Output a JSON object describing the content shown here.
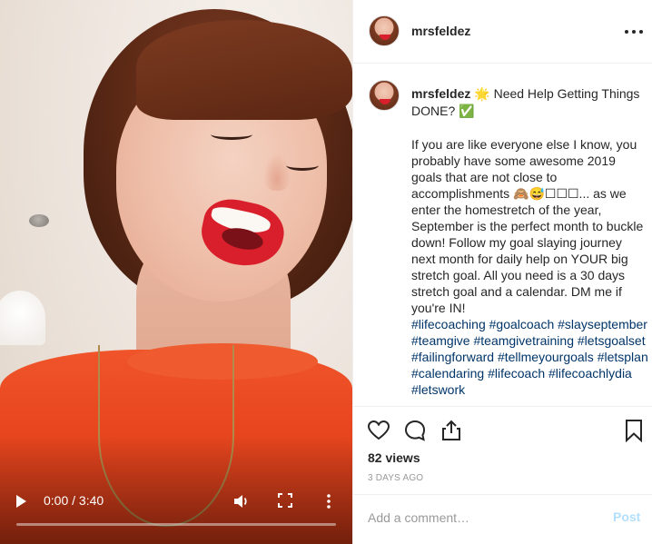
{
  "post": {
    "username": "mrsfeldez",
    "caption_headline_emoji": "🌟",
    "caption_headline": "Need Help Getting Things DONE?",
    "caption_headline_check": "✅",
    "caption_body": "If you are like everyone else I know, you probably have some awesome 2019 goals that are not close to accomplishments 🙈😅☐☐☐... as we enter the homestretch of the year, September is the perfect month to buckle down! Follow my goal slaying journey next month for daily help on YOUR big stretch goal. All you need is a 30 days stretch goal and a calendar. DM me if you're IN!",
    "hashtags": [
      "#lifecoaching",
      "#goalcoach",
      "#slayseptember",
      "#teamgive",
      "#teamgivetraining",
      "#letsgoalset",
      "#failingforward",
      "#tellmeyourgoals",
      "#letsplan",
      "#calendaring",
      "#lifecoach",
      "#lifecoachlydia",
      "#letswork"
    ],
    "views": "82 views",
    "date": "3 DAYS AGO"
  },
  "video": {
    "time": "0:00 / 3:40",
    "progress": 0
  },
  "comment": {
    "placeholder": "Add a comment…",
    "post_label": "Post"
  },
  "icons": {
    "more": "more-horizontal-icon",
    "like": "heart-icon",
    "comment": "comment-bubble-icon",
    "share": "share-upload-icon",
    "save": "bookmark-icon",
    "play": "play-icon",
    "volume": "volume-icon",
    "fullscreen": "fullscreen-icon",
    "video_more": "more-vertical-icon"
  },
  "colors": {
    "hashtag": "#003569",
    "post_button_disabled": "#b2dffc",
    "muted_text": "#999999"
  }
}
